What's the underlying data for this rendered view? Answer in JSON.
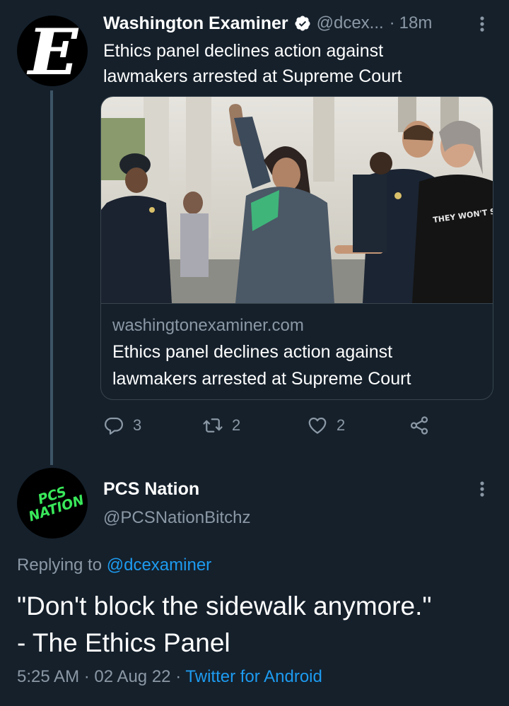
{
  "tweet": {
    "author_name": "Washington Examiner",
    "handle": "@dcex...",
    "separator": "·",
    "time": "18m",
    "avatar_glyph": "E",
    "text": "Ethics panel declines action against lawmakers arrested at Supreme Court",
    "card": {
      "sign_text": "THEY WON'T STOP AT ADE",
      "domain": "washingtonexaminer.com",
      "title": "Ethics panel declines action against lawmakers arrested at Supreme Court"
    },
    "actions": {
      "reply_count": "3",
      "retweet_count": "2",
      "like_count": "2"
    },
    "icons": [
      "verified-badge-icon",
      "more-icon",
      "reply-icon",
      "retweet-icon",
      "like-icon",
      "share-icon"
    ]
  },
  "reply": {
    "author_name": "PCS Nation",
    "handle": "@PCSNationBitchz",
    "avatar_line1": "PCS",
    "avatar_line2": "NATION",
    "replying_prefix": "Replying to",
    "replying_to": "@dcexaminer",
    "text_line1": "\"Don't block the sidewalk anymore.\"",
    "text_line2": "- The Ethics Panel",
    "time": "5:25 AM",
    "sep1": "·",
    "date": "02 Aug 22",
    "sep2": "·",
    "source": "Twitter for Android"
  },
  "colors": {
    "background": "#15202b",
    "secondary_text": "#8b98a5",
    "link": "#1d9bf0",
    "border": "#38444d",
    "logo_green": "#39e85a"
  }
}
